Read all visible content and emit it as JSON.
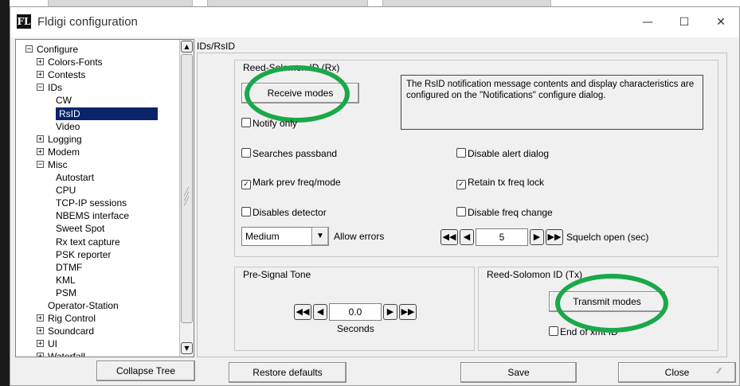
{
  "window": {
    "title": "Fldigi configuration",
    "app_icon": "FL",
    "minimize": "—",
    "maximize": "☐",
    "close": "✕"
  },
  "tree": {
    "items": [
      {
        "label": "Configure",
        "expander": "−",
        "level": 0
      },
      {
        "label": "Colors-Fonts",
        "expander": "+",
        "level": 1
      },
      {
        "label": "Contests",
        "expander": "+",
        "level": 1
      },
      {
        "label": "IDs",
        "expander": "−",
        "level": 1
      },
      {
        "label": "CW",
        "expander": "",
        "level": 2
      },
      {
        "label": "RsID",
        "expander": "",
        "level": 2,
        "selected": true
      },
      {
        "label": "Video",
        "expander": "",
        "level": 2
      },
      {
        "label": "Logging",
        "expander": "+",
        "level": 1
      },
      {
        "label": "Modem",
        "expander": "+",
        "level": 1
      },
      {
        "label": "Misc",
        "expander": "−",
        "level": 1
      },
      {
        "label": "Autostart",
        "expander": "",
        "level": 2
      },
      {
        "label": "CPU",
        "expander": "",
        "level": 2
      },
      {
        "label": "TCP-IP sessions",
        "expander": "",
        "level": 2
      },
      {
        "label": "NBEMS interface",
        "expander": "",
        "level": 2
      },
      {
        "label": "Sweet Spot",
        "expander": "",
        "level": 2
      },
      {
        "label": "Rx text capture",
        "expander": "",
        "level": 2
      },
      {
        "label": "PSK reporter",
        "expander": "",
        "level": 2
      },
      {
        "label": "DTMF",
        "expander": "",
        "level": 2
      },
      {
        "label": "KML",
        "expander": "",
        "level": 2
      },
      {
        "label": "PSM",
        "expander": "",
        "level": 2
      },
      {
        "label": "Operator-Station",
        "expander": "",
        "level": 1
      },
      {
        "label": "Rig Control",
        "expander": "+",
        "level": 1
      },
      {
        "label": "Soundcard",
        "expander": "+",
        "level": 1
      },
      {
        "label": "UI",
        "expander": "+",
        "level": 1
      },
      {
        "label": "Waterfall",
        "expander": "+",
        "level": 1
      }
    ],
    "scroll_up": "▲",
    "scroll_down": "▼"
  },
  "panel": {
    "tab_label": "IDs/RsID",
    "rx_group": {
      "title": "Reed-Solomon ID (Rx)",
      "receive_modes": "Receive modes",
      "note": "The RsID notification message contents and display characteristics are configured on the \"Notifications\" configure dialog.",
      "notify_only": {
        "label": "Notify only",
        "checked": false
      },
      "searches_passband": {
        "label": "Searches passband",
        "checked": false
      },
      "disable_alert": {
        "label": "Disable alert dialog",
        "checked": false
      },
      "mark_prev": {
        "label": "Mark prev freq/mode",
        "checked": true
      },
      "retain_tx": {
        "label": "Retain tx freq lock",
        "checked": true
      },
      "disables_detector": {
        "label": "Disables detector",
        "checked": false
      },
      "disable_freq_change": {
        "label": "Disable freq change",
        "checked": false
      },
      "errors_select": "Medium",
      "errors_label": "Allow errors",
      "squelch_value": "5",
      "squelch_label": "Squelch open (sec)"
    },
    "pre_signal": {
      "title": "Pre-Signal Tone",
      "value": "0.0",
      "unit": "Seconds"
    },
    "tx_group": {
      "title": "Reed-Solomon ID (Tx)",
      "transmit_modes": "Transmit modes",
      "end_of_xmt": {
        "label": "End of xmt ID",
        "checked": false
      }
    }
  },
  "glyphs": {
    "check": "✓",
    "fast_back": "◀◀",
    "back": "◀",
    "fwd": "▶",
    "fast_fwd": "▶▶",
    "dropdown": "▼"
  },
  "buttons": {
    "collapse_tree": "Collapse Tree",
    "restore_defaults": "Restore defaults",
    "save": "Save",
    "close": "Close"
  },
  "annotation_color": "#1aa84a"
}
